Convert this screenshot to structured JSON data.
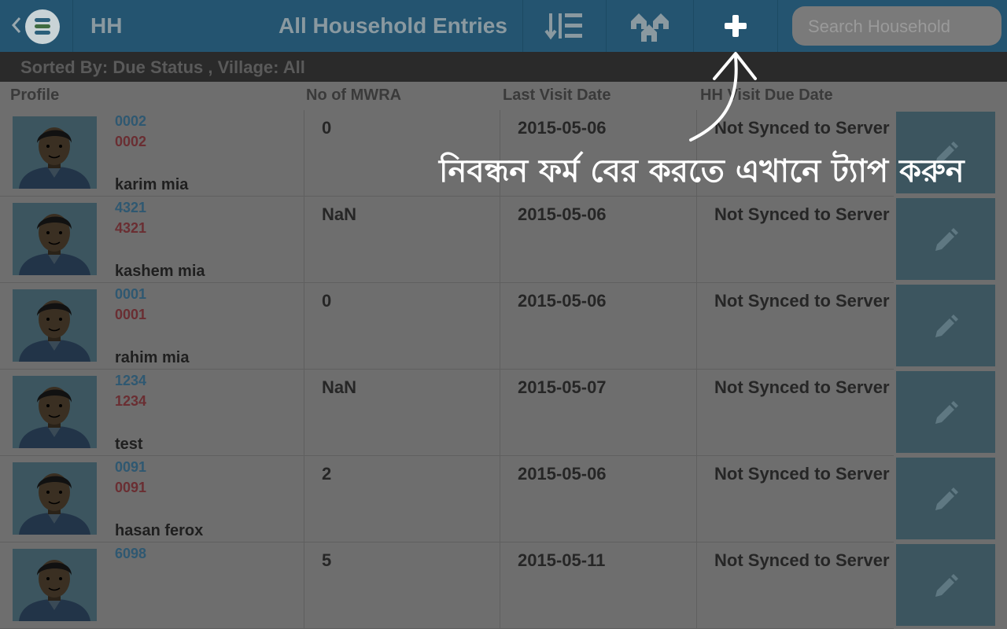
{
  "header": {
    "hh_label": "HH",
    "title": "All Household Entries",
    "search_placeholder": "Search Household"
  },
  "toolbar_icons": [
    "back-icon",
    "app-logo-icon",
    "sort-icon",
    "households-icon",
    "add-icon"
  ],
  "sort_info": {
    "text": "Sorted By: Due Status  , Village: All"
  },
  "columns": {
    "profile": "Profile",
    "mwra": "No of MWRA",
    "last_visit": "Last Visit Date",
    "due_date": "HH Visit Due Date"
  },
  "rows": [
    {
      "id1": "0002",
      "id2": "0002",
      "name": "karim mia",
      "mwra": "0",
      "last_visit": "2015-05-06",
      "due": "Not Synced to Server"
    },
    {
      "id1": "4321",
      "id2": "4321",
      "name": "kashem mia",
      "mwra": "NaN",
      "last_visit": "2015-05-06",
      "due": "Not Synced to Server"
    },
    {
      "id1": "0001",
      "id2": "0001",
      "name": "rahim mia",
      "mwra": "0",
      "last_visit": "2015-05-06",
      "due": "Not Synced to Server"
    },
    {
      "id1": "1234",
      "id2": "1234",
      "name": "test",
      "mwra": "NaN",
      "last_visit": "2015-05-07",
      "due": "Not Synced to Server"
    },
    {
      "id1": "0091",
      "id2": "0091",
      "name": "hasan ferox",
      "mwra": "2",
      "last_visit": "2015-05-06",
      "due": "Not Synced to Server"
    },
    {
      "id1": "6098",
      "id2": "",
      "name": "",
      "mwra": "5",
      "last_visit": "2015-05-11",
      "due": "Not Synced to Server"
    }
  ],
  "annotation": {
    "text": "নিবন্ধন ফর্ম বের করতে এখানে ট্যাপ করুন"
  },
  "colors": {
    "header_bg": "#245470",
    "overlay_bg": "#6e6e6e",
    "id_primary": "#2f5871",
    "id_secondary": "#6a2e32",
    "avatar_bg": "#3c555f"
  }
}
